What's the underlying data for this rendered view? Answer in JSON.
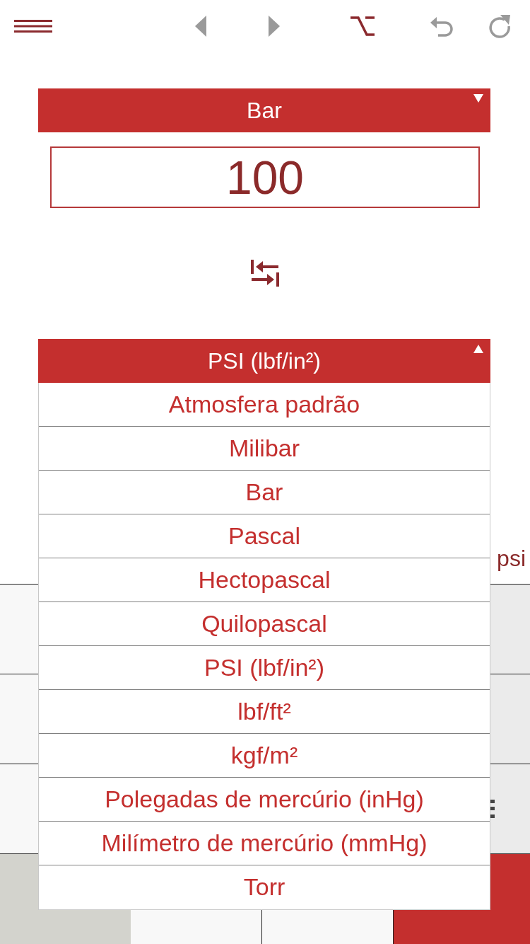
{
  "toolbar": {
    "buttons": [
      {
        "kind": "menu"
      },
      {
        "kind": "back"
      },
      {
        "kind": "forward"
      },
      {
        "kind": "alt"
      },
      {
        "kind": "undo"
      },
      {
        "kind": "redo"
      }
    ]
  },
  "from_unit": {
    "label": "Bar",
    "expanded": false
  },
  "input": {
    "value": "100"
  },
  "to_unit": {
    "label": "PSI (lbf/in²)",
    "expanded": true,
    "options": [
      "Atmosfera padrão",
      "Milibar",
      "Bar",
      "Pascal",
      "Hectopascal",
      "Quilopascal",
      "PSI (lbf/in²)",
      "lbf/ft²",
      "kgf/m²",
      "Polegadas de mercúrio (inHg)",
      "Milímetro de mercúrio (mmHg)",
      "Torr"
    ]
  },
  "result": {
    "unit": "psi"
  },
  "keypad": [
    {
      "keys": [
        {
          "kind": "side"
        },
        {
          "kind": "function"
        }
      ]
    },
    {
      "keys": [
        {
          "kind": "side"
        },
        {
          "kind": "function"
        }
      ]
    },
    {
      "keys": [
        {
          "kind": "side"
        },
        {
          "kind": "function",
          "glyph": true
        }
      ]
    },
    {
      "keys": [
        {
          "kind": "grey"
        },
        {
          "kind": "plain"
        },
        {
          "kind": "plain"
        },
        {
          "kind": "accent"
        }
      ]
    }
  ]
}
